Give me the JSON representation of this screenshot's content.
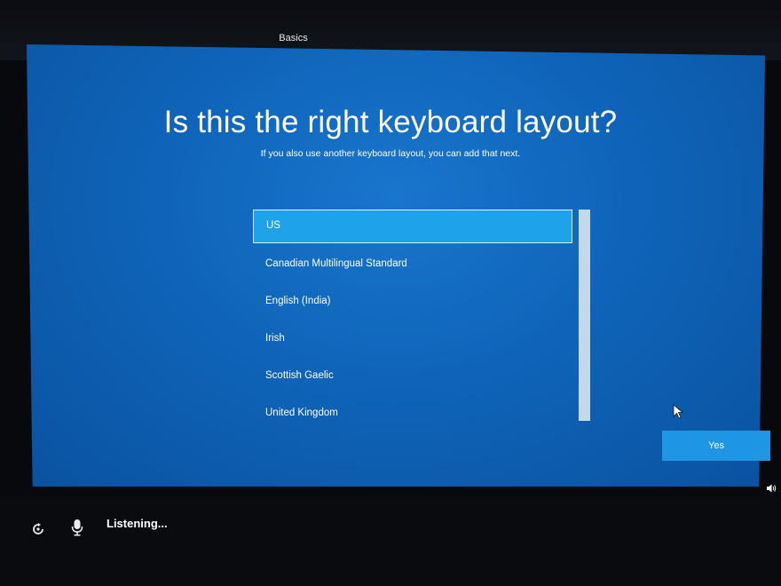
{
  "header": {
    "tab_label": "Basics"
  },
  "main": {
    "title": "Is this the right keyboard layout?",
    "subtitle": "If you also use another keyboard layout, you can add that next.",
    "layouts": [
      "US",
      "Canadian Multilingual Standard",
      "English (India)",
      "Irish",
      "Scottish Gaelic",
      "United Kingdom"
    ],
    "selected_layout": "US",
    "yes_label": "Yes"
  },
  "footer": {
    "status": "Listening..."
  },
  "icons": {
    "ease_of_access": "ease-of-access-icon",
    "microphone": "microphone-icon",
    "volume": "volume-icon",
    "cursor": "mouse-cursor"
  },
  "colors": {
    "background": "#0f64b9",
    "selected_item": "#1ea2ea",
    "button": "#1f96e3"
  }
}
